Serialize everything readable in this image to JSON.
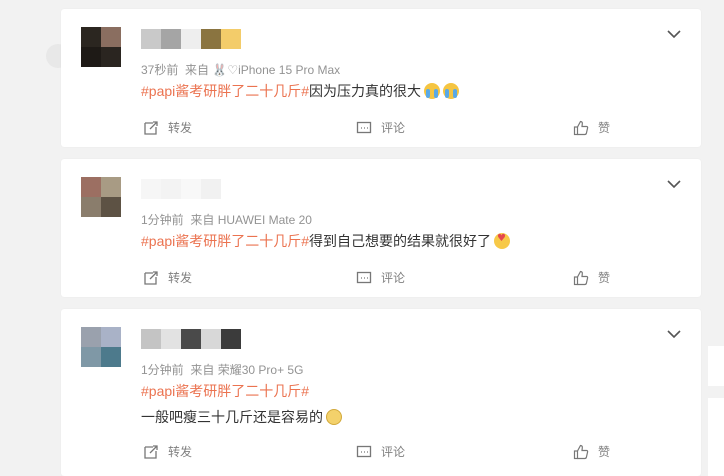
{
  "colors": {
    "tag": "#eb7350",
    "text": "#333333",
    "meta": "#939393",
    "action": "#808080",
    "page_bg": "#f2f2f2",
    "card_bg": "#ffffff"
  },
  "actions": {
    "repost_label": "转发",
    "comment_label": "评论",
    "like_label": "赞"
  },
  "icons": {
    "repost": "repost-icon",
    "comment": "comment-icon",
    "like": "thumbs-up-icon",
    "more": "chevron-down-icon"
  },
  "posts": [
    {
      "meta_time": "37秒前",
      "meta_from": "来自",
      "meta_device": "🐰♡iPhone 15 Pro Max",
      "hashtag": "#papi酱考研胖了二十几斤#",
      "text": "因为压力真的很大",
      "emojis": [
        "crying-face",
        "crying-face"
      ]
    },
    {
      "meta_time": "1分钟前",
      "meta_from": "来自",
      "meta_device": "HUAWEI Mate 20",
      "hashtag": "#papi酱考研胖了二十几斤#",
      "text": "得到自己想要的结果就很好了",
      "emojis": [
        "heart-eyes-face"
      ]
    },
    {
      "meta_time": "1分钟前",
      "meta_from": "来自",
      "meta_device": "荣耀30 Pro+ 5G",
      "hashtag": "#papi酱考研胖了二十几斤#",
      "text": "一般吧瘦三十几斤还是容易的",
      "emojis": [
        "smirk-face"
      ]
    }
  ]
}
